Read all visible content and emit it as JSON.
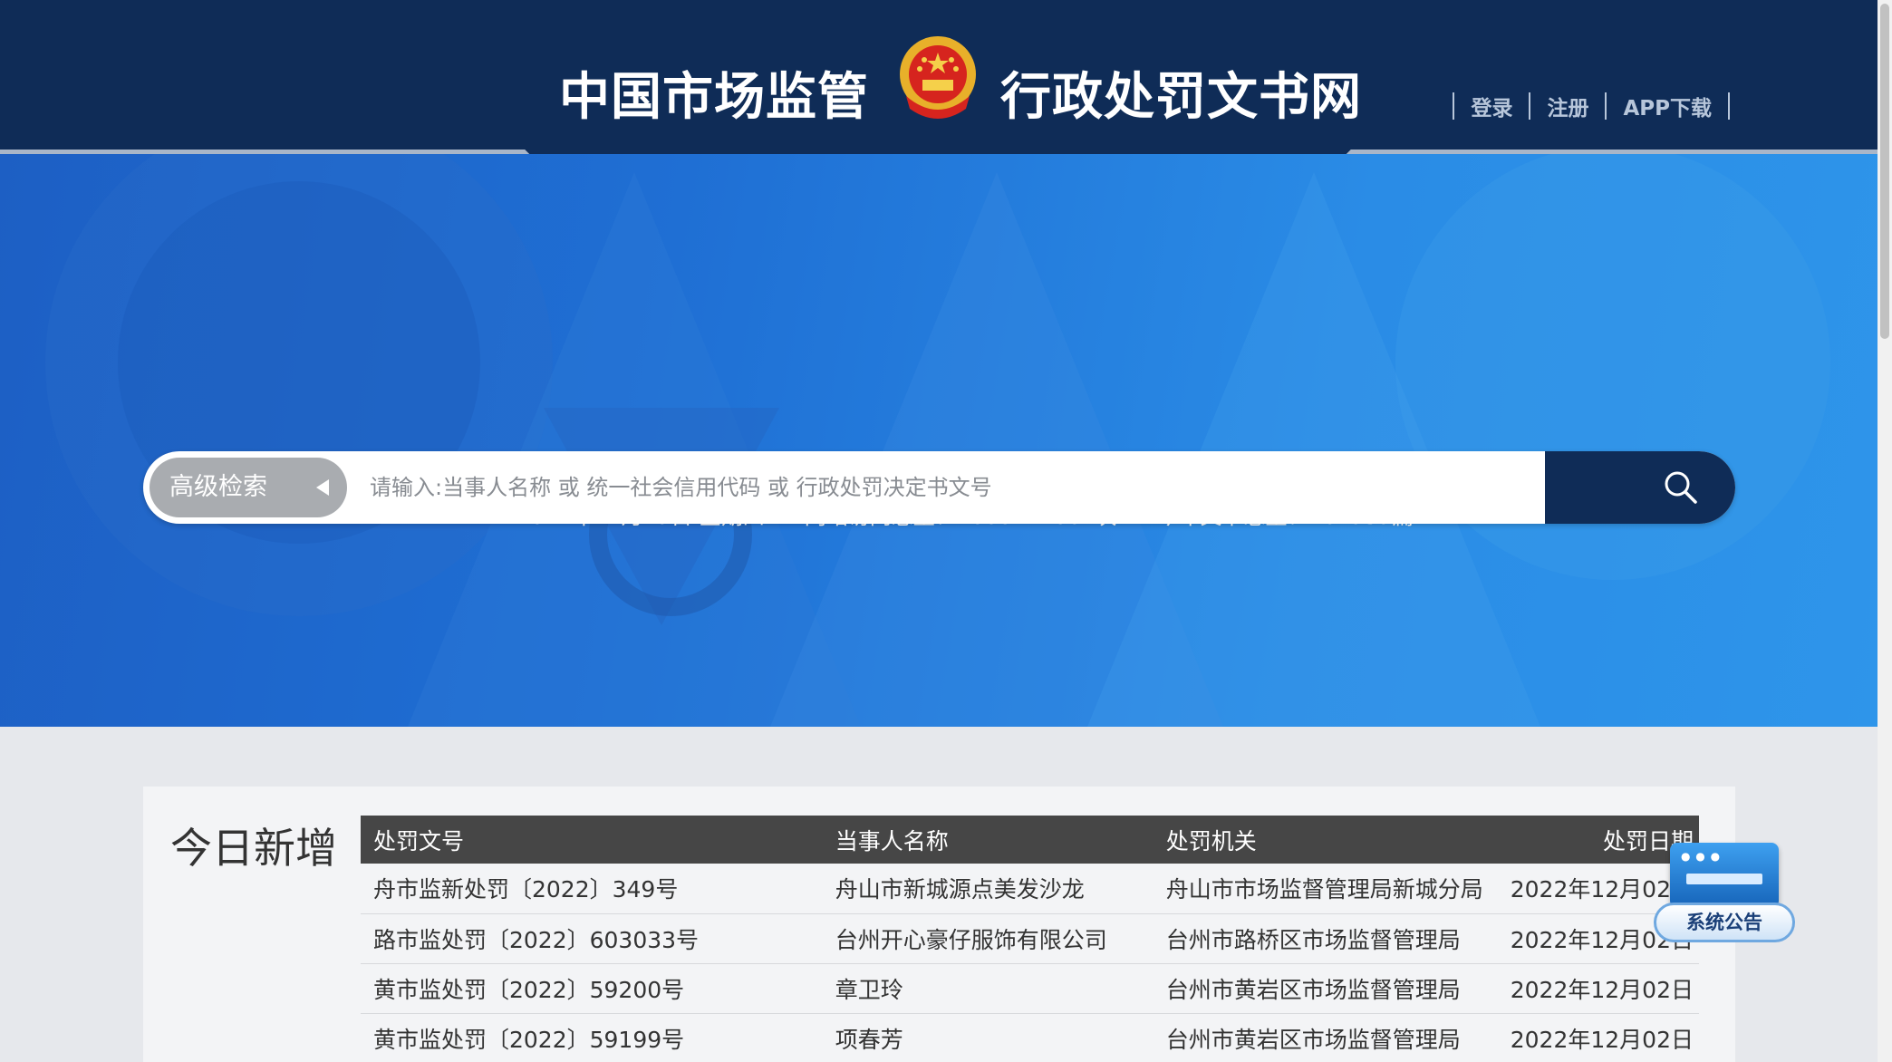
{
  "header": {
    "title_left": "中国市场监管",
    "title_right": "行政处罚文书网",
    "links": [
      "登录",
      "注册",
      "APP下载"
    ]
  },
  "stats": {
    "date": "2022年12月29日 星期四",
    "visits": "网站访问总量：1808277067次",
    "docs": "今年文书总量：164959篇"
  },
  "search": {
    "advanced_label": "高级检索",
    "placeholder": "请输入:当事人名称 或 统一社会信用代码 或 行政处罚决定书文号"
  },
  "today": {
    "title": "今日新增",
    "columns": [
      "处罚文号",
      "当事人名称",
      "处罚机关",
      "处罚日期"
    ],
    "rows": [
      [
        "舟市监新处罚〔2022〕349号",
        "舟山市新城源点美发沙龙",
        "舟山市市场监督管理局新城分局",
        "2022年12月02日"
      ],
      [
        "路市监处罚〔2022〕603033号",
        "台州开心豪仔服饰有限公司",
        "台州市路桥区市场监督管理局",
        "2022年12月02日"
      ],
      [
        "黄市监处罚〔2022〕59200号",
        "章卫玲",
        "台州市黄岩区市场监督管理局",
        "2022年12月02日"
      ],
      [
        "黄市监处罚〔2022〕59199号",
        "项春芳",
        "台州市黄岩区市场监督管理局",
        "2022年12月02日"
      ]
    ]
  },
  "notice": {
    "label": "系统公告"
  },
  "colors": {
    "header": "#0f2c57",
    "banner": "#1f6fd4",
    "table_header": "#464646"
  }
}
